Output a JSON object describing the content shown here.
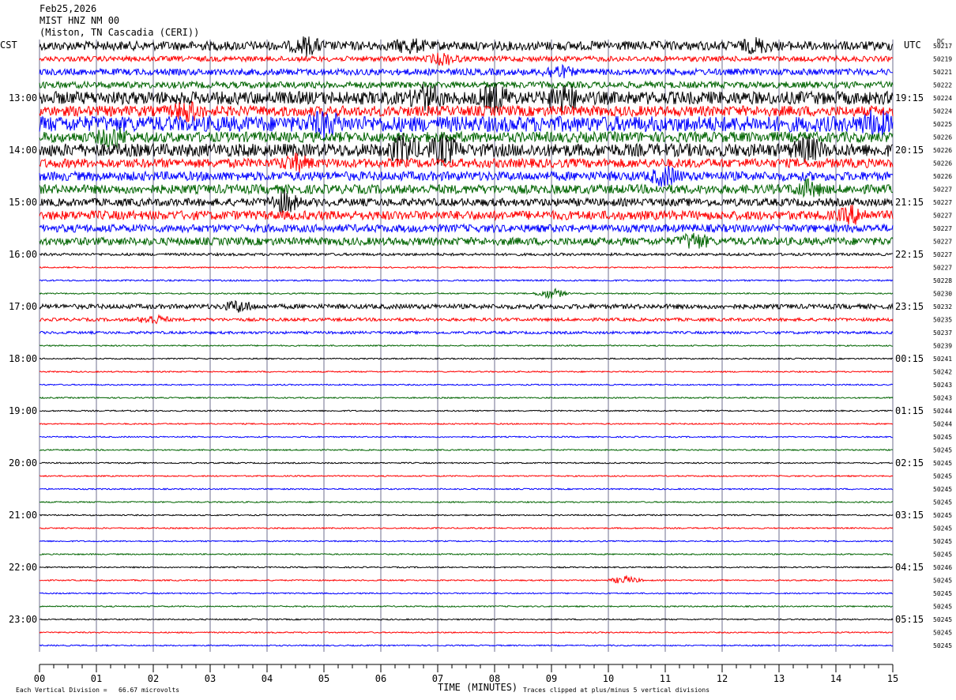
{
  "header": {
    "date": "Feb25,2026",
    "station": "MIST HNZ NM 00",
    "location": "(Miston, TN Cascadia (CERI))"
  },
  "left_timezone": "CST",
  "right_timezone": "UTC",
  "dc_label": "DC",
  "footer": {
    "scale_note": "Each Vertical Division =   66.67 microvolts",
    "clip_note": "Traces clipped at plus/minus 5 vertical divisions"
  },
  "trace_colors": [
    "#000000",
    "#ff0000",
    "#0000ff",
    "#006400"
  ],
  "grid_color": "#6f6f8f",
  "chart_data": {
    "type": "line",
    "title": "",
    "xlabel": "TIME (MINUTES)",
    "ylabel": "",
    "xlim": [
      0,
      15
    ],
    "x_ticks": [
      "00",
      "01",
      "02",
      "03",
      "04",
      "05",
      "06",
      "07",
      "08",
      "09",
      "10",
      "11",
      "12",
      "13",
      "14",
      "15"
    ],
    "left_time_labels": [
      "13:00",
      "14:00",
      "15:00",
      "16:00",
      "17:00",
      "18:00",
      "19:00",
      "20:00",
      "21:00",
      "22:00",
      "23:00"
    ],
    "right_time_labels": [
      "19:15",
      "20:15",
      "21:15",
      "22:15",
      "23:15",
      "00:15",
      "01:15",
      "02:15",
      "03:15",
      "04:15",
      "05:15"
    ],
    "dc_offsets": [
      "50217",
      "50219",
      "50221",
      "50222",
      "50224",
      "50224",
      "50225",
      "50226",
      "50226",
      "50226",
      "50226",
      "50227",
      "50227",
      "50227",
      "50227",
      "50227",
      "50227",
      "50227",
      "50228",
      "50230",
      "50232",
      "50235",
      "50237",
      "50239",
      "50241",
      "50242",
      "50243",
      "50243",
      "50244",
      "50244",
      "50245",
      "50245",
      "50245",
      "50245",
      "50245",
      "50245",
      "50245",
      "50245",
      "50245",
      "50245",
      "50246",
      "50245",
      "50245",
      "50245",
      "50245",
      "50245",
      "50245"
    ],
    "trace_amplitude": [
      0.35,
      0.2,
      0.25,
      0.25,
      0.5,
      0.4,
      0.6,
      0.4,
      0.5,
      0.35,
      0.35,
      0.35,
      0.3,
      0.35,
      0.3,
      0.3,
      0.1,
      0.05,
      0.06,
      0.05,
      0.18,
      0.12,
      0.1,
      0.05,
      0.05,
      0.05,
      0.05,
      0.05,
      0.05,
      0.05,
      0.05,
      0.05,
      0.05,
      0.05,
      0.05,
      0.05,
      0.05,
      0.05,
      0.05,
      0.05,
      0.05,
      0.05,
      0.05,
      0.05,
      0.05,
      0.05,
      0.05
    ],
    "events": [
      {
        "row": 0,
        "minute": 4.7,
        "amp": 0.5
      },
      {
        "row": 0,
        "minute": 6.5,
        "amp": 0.4
      },
      {
        "row": 0,
        "minute": 12.6,
        "amp": 0.4
      },
      {
        "row": 1,
        "minute": 7.1,
        "amp": 0.4
      },
      {
        "row": 2,
        "minute": 9.1,
        "amp": 0.4
      },
      {
        "row": 4,
        "minute": 6.8,
        "amp": 0.8
      },
      {
        "row": 4,
        "minute": 8.0,
        "amp": 0.8
      },
      {
        "row": 4,
        "minute": 9.2,
        "amp": 0.9
      },
      {
        "row": 5,
        "minute": 2.6,
        "amp": 0.6
      },
      {
        "row": 6,
        "minute": 5.0,
        "amp": 0.6
      },
      {
        "row": 6,
        "minute": 14.7,
        "amp": 0.7
      },
      {
        "row": 7,
        "minute": 1.3,
        "amp": 0.6
      },
      {
        "row": 8,
        "minute": 6.4,
        "amp": 0.9
      },
      {
        "row": 8,
        "minute": 7.1,
        "amp": 0.9
      },
      {
        "row": 8,
        "minute": 13.5,
        "amp": 0.7
      },
      {
        "row": 9,
        "minute": 4.5,
        "amp": 0.5
      },
      {
        "row": 10,
        "minute": 11.0,
        "amp": 0.6
      },
      {
        "row": 11,
        "minute": 13.5,
        "amp": 0.5
      },
      {
        "row": 12,
        "minute": 4.3,
        "amp": 0.7
      },
      {
        "row": 13,
        "minute": 14.3,
        "amp": 0.5
      },
      {
        "row": 15,
        "minute": 11.5,
        "amp": 0.5
      },
      {
        "row": 19,
        "minute": 9.0,
        "amp": 0.4
      },
      {
        "row": 20,
        "minute": 3.5,
        "amp": 0.4
      },
      {
        "row": 21,
        "minute": 2.0,
        "amp": 0.35
      },
      {
        "row": 41,
        "minute": 10.3,
        "amp": 0.3
      }
    ]
  }
}
